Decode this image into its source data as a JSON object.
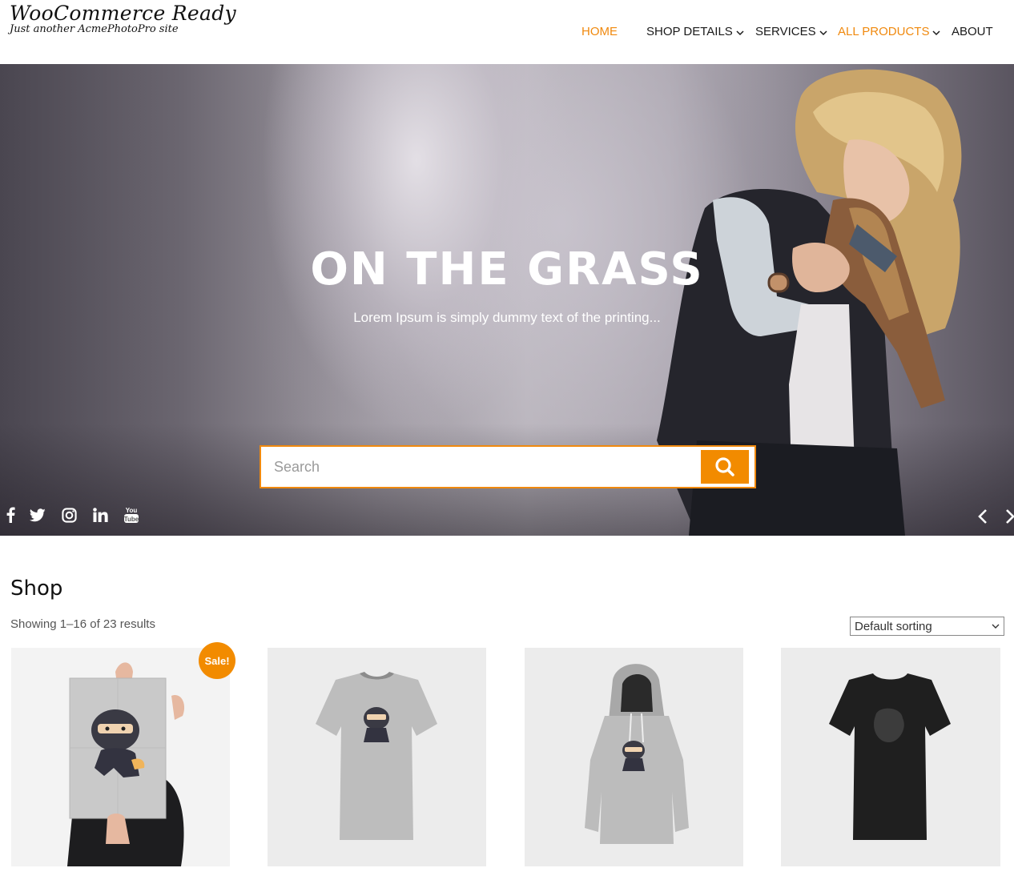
{
  "site": {
    "title": "WooCommerce Ready",
    "tagline": "Just another AcmePhotoPro site"
  },
  "nav": {
    "items": [
      {
        "label": "HOME",
        "active": true,
        "dropdown": false
      },
      {
        "label": "SHOP DETAILS",
        "active": false,
        "dropdown": true
      },
      {
        "label": "SERVICES",
        "active": false,
        "dropdown": true
      },
      {
        "label": "ALL PRODUCTS",
        "active": true,
        "dropdown": true
      },
      {
        "label": "ABOUT",
        "active": false,
        "dropdown": false
      }
    ]
  },
  "hero": {
    "title": "ON THE GRASS",
    "subtitle": "Lorem Ipsum is simply dummy text of the printing...",
    "search_placeholder": "Search",
    "social_icons": [
      "facebook-icon",
      "twitter-icon",
      "instagram-icon",
      "linkedin-icon",
      "youtube-icon"
    ]
  },
  "shop": {
    "title": "Shop",
    "result_count": "Showing 1–16 of 23 results",
    "sorting": "Default sorting",
    "sale_badge": "Sale!",
    "products": [
      {
        "image": "ninja-poster",
        "on_sale": true
      },
      {
        "image": "grey-ninja-tshirt",
        "on_sale": false
      },
      {
        "image": "grey-ninja-hoodie",
        "on_sale": false
      },
      {
        "image": "black-tshirt",
        "on_sale": false
      }
    ]
  },
  "colors": {
    "accent": "#f0890e",
    "button": "#f28b00",
    "text": "#1a1a1a"
  }
}
